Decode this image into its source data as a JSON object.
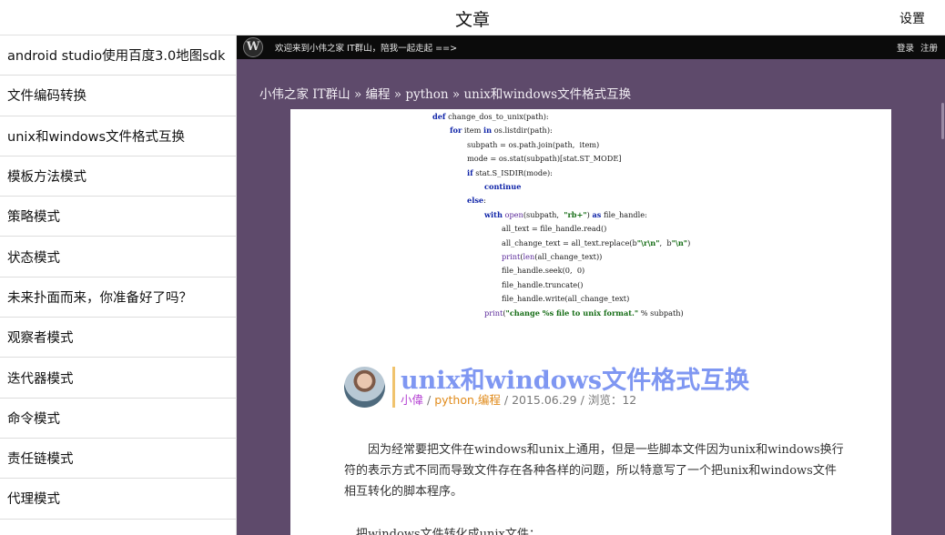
{
  "header": {
    "title": "文章",
    "settings_label": "设置"
  },
  "sidebar": {
    "items": [
      {
        "label": "android studio使用百度3.0地图sdk"
      },
      {
        "label": "文件编码转换"
      },
      {
        "label": "unix和windows文件格式互换"
      },
      {
        "label": "模板方法模式"
      },
      {
        "label": "策略模式"
      },
      {
        "label": "状态模式"
      },
      {
        "label": "未来扑面而来，你准备好了吗？"
      },
      {
        "label": "观察者模式"
      },
      {
        "label": "迭代器模式"
      },
      {
        "label": "命令模式"
      },
      {
        "label": "责任链模式"
      },
      {
        "label": "代理模式"
      }
    ]
  },
  "wp_bar": {
    "logo_letter": "W",
    "welcome": "欢迎来到小伟之家 IT群山，陪我一起走起 ==>",
    "login": "登录",
    "register": "注册"
  },
  "breadcrumb": {
    "home": "小伟之家 IT群山",
    "separator": "»",
    "category1": "编程",
    "category2": "python",
    "current": "unix和windows文件格式互换"
  },
  "code_lines": [
    {
      "indent": 0,
      "parts": [
        {
          "t": "def",
          "c": "kw"
        },
        {
          "t": " change_dos_to_unix(path):",
          "c": ""
        }
      ]
    },
    {
      "indent": 1,
      "parts": [
        {
          "t": "for",
          "c": "kw"
        },
        {
          "t": " item ",
          "c": ""
        },
        {
          "t": "in",
          "c": "kw"
        },
        {
          "t": " os.listdir(path):",
          "c": ""
        }
      ]
    },
    {
      "indent": 2,
      "parts": [
        {
          "t": "subpath = os.path.join(path,  item)",
          "c": ""
        }
      ]
    },
    {
      "indent": 2,
      "parts": [
        {
          "t": "mode = os.stat(subpath)[stat.ST_MODE]",
          "c": ""
        }
      ]
    },
    {
      "indent": 2,
      "parts": [
        {
          "t": "if",
          "c": "kw"
        },
        {
          "t": " stat.S_ISDIR(mode):",
          "c": ""
        }
      ]
    },
    {
      "indent": 3,
      "parts": [
        {
          "t": "continue",
          "c": "kw"
        }
      ]
    },
    {
      "indent": 2,
      "parts": [
        {
          "t": "else",
          "c": "kw"
        },
        {
          "t": ":",
          "c": ""
        }
      ]
    },
    {
      "indent": 3,
      "parts": [
        {
          "t": "with",
          "c": "kw"
        },
        {
          "t": " ",
          "c": ""
        },
        {
          "t": "open",
          "c": "fn"
        },
        {
          "t": "(subpath,  ",
          "c": ""
        },
        {
          "t": "\"rb+\"",
          "c": "str"
        },
        {
          "t": ") ",
          "c": ""
        },
        {
          "t": "as",
          "c": "kw"
        },
        {
          "t": " file_handle:",
          "c": ""
        }
      ]
    },
    {
      "indent": 4,
      "parts": [
        {
          "t": "all_text = file_handle.read()",
          "c": ""
        }
      ]
    },
    {
      "indent": 4,
      "parts": [
        {
          "t": "all_change_text = all_text.replace(b",
          "c": ""
        },
        {
          "t": "\"\\r\\n\"",
          "c": "str"
        },
        {
          "t": ",  b",
          "c": ""
        },
        {
          "t": "\"\\n\"",
          "c": "str"
        },
        {
          "t": ")",
          "c": ""
        }
      ]
    },
    {
      "indent": 4,
      "parts": [
        {
          "t": "print",
          "c": "fn"
        },
        {
          "t": "(",
          "c": ""
        },
        {
          "t": "len",
          "c": "fn"
        },
        {
          "t": "(all_change_text))",
          "c": ""
        }
      ]
    },
    {
      "indent": 4,
      "parts": [
        {
          "t": "file_handle.seek(0,  0)",
          "c": ""
        }
      ]
    },
    {
      "indent": 4,
      "parts": [
        {
          "t": "file_handle.truncate()",
          "c": ""
        }
      ]
    },
    {
      "indent": 4,
      "parts": [
        {
          "t": "file_handle.write(all_change_text)",
          "c": ""
        }
      ]
    },
    {
      "indent": 3,
      "parts": [
        {
          "t": "print",
          "c": "fn"
        },
        {
          "t": "(",
          "c": ""
        },
        {
          "t": "\"change %s file to unix format.\"",
          "c": "str"
        },
        {
          "t": " % subpath)",
          "c": ""
        }
      ]
    }
  ],
  "post": {
    "title": "unix和windows文件格式互换",
    "author": "小偉",
    "sep": " / ",
    "categories": "python,编程",
    "date": "2015.06.29",
    "views_label": "浏览：12",
    "paragraph1": "因为经常要把文件在windows和unix上通用，但是一些脚本文件因为unix和windows换行符的表示方式不同而导致文件存在各种各样的问题，所以特意写了一个把unix和windows文件相互转化的脚本程序。",
    "paragraph2": "把windows文件转化成unix文件："
  },
  "colors": {
    "content_bg": "#5e4a6b",
    "title_blue": "#7f97f2",
    "author_purple": "#b33fd2",
    "category_orange": "#e08a1a"
  }
}
